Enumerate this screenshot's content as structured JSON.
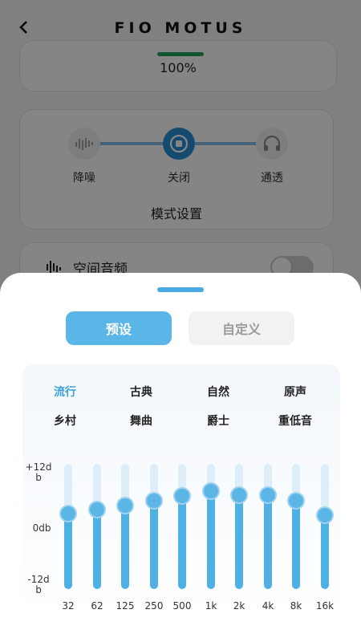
{
  "header": {
    "back_icon": "chevron-left-icon",
    "title": "FIO MOTUS"
  },
  "battery": {
    "percent_text": "100%",
    "level": 1.0,
    "bar_color": "#19a15a"
  },
  "mode": {
    "items": [
      {
        "label": "降噪",
        "icon": "noise-bars-icon"
      },
      {
        "label": "关闭",
        "icon": "stop-circle-icon"
      },
      {
        "label": "通透",
        "icon": "headphones-icon"
      }
    ],
    "active_index": 1,
    "title": "模式设置"
  },
  "spatial_audio": {
    "label": "空间音频",
    "icon": "audio-wave-icon",
    "enabled": false
  },
  "sheet": {
    "tabs": [
      {
        "label": "预设"
      },
      {
        "label": "自定义"
      }
    ],
    "active_tab": 0,
    "presets": [
      "流行",
      "古典",
      "自然",
      "原声",
      "乡村",
      "舞曲",
      "爵士",
      "重低音"
    ],
    "active_preset": 0,
    "y_axis": {
      "top": "+12d\nb",
      "mid": "0db",
      "bottom": "-12d\nb",
      "range_db": [
        -12,
        12
      ]
    },
    "bands": [
      {
        "freq": "32",
        "gain_db": 2.5
      },
      {
        "freq": "62",
        "gain_db": 3.2
      },
      {
        "freq": "125",
        "gain_db": 4.0
      },
      {
        "freq": "250",
        "gain_db": 5.0
      },
      {
        "freq": "500",
        "gain_db": 5.8
      },
      {
        "freq": "1k",
        "gain_db": 6.8
      },
      {
        "freq": "2k",
        "gain_db": 6.0
      },
      {
        "freq": "4k",
        "gain_db": 6.0
      },
      {
        "freq": "8k",
        "gain_db": 5.0
      },
      {
        "freq": "16k",
        "gain_db": 2.2
      }
    ],
    "accent_color": "#4fb0e3"
  }
}
